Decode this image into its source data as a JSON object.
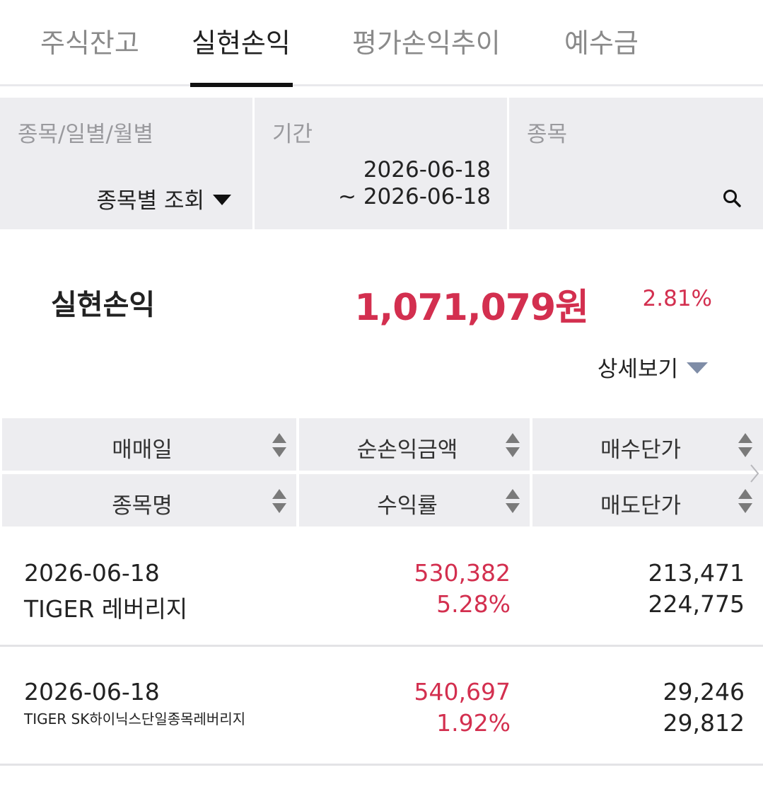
{
  "tabs": [
    {
      "label": "주식잔고"
    },
    {
      "label": "실현손익"
    },
    {
      "label": "평가손익추이"
    },
    {
      "label": "예수금"
    }
  ],
  "filter": {
    "mode_label": "종목/일별/월별",
    "mode_value": "종목별 조회",
    "period_label": "기간",
    "period_start": "2026-06-18",
    "period_end": "~ 2026-06-18",
    "stock_label": "종목"
  },
  "summary": {
    "label": "실현손익",
    "amount": "1,071,079원",
    "rate": "2.81%",
    "detail_label": "상세보기"
  },
  "table": {
    "headers_row1": [
      "매매일",
      "순손익금액",
      "매수단가"
    ],
    "headers_row2": [
      "종목명",
      "수익률",
      "매도단가"
    ],
    "rows": [
      {
        "date": "2026-06-18",
        "name": "TIGER 레버리지",
        "profit": "530,382",
        "rate": "5.28%",
        "buy": "213,471",
        "sell": "224,775"
      },
      {
        "date": "2026-06-18",
        "name": "TIGER SK하이닉스단일종목레버리지",
        "profit": "540,697",
        "rate": "1.92%",
        "buy": "29,246",
        "sell": "29,812"
      }
    ]
  },
  "colors": {
    "accent_red": "#d32f4f",
    "panel_gray": "#ededf0",
    "active_tab": "#111111"
  },
  "icons": [
    "search-icon",
    "dropdown-arrow-icon",
    "expand-triangle-icon",
    "sort-icon",
    "chevron-right-icon"
  ]
}
